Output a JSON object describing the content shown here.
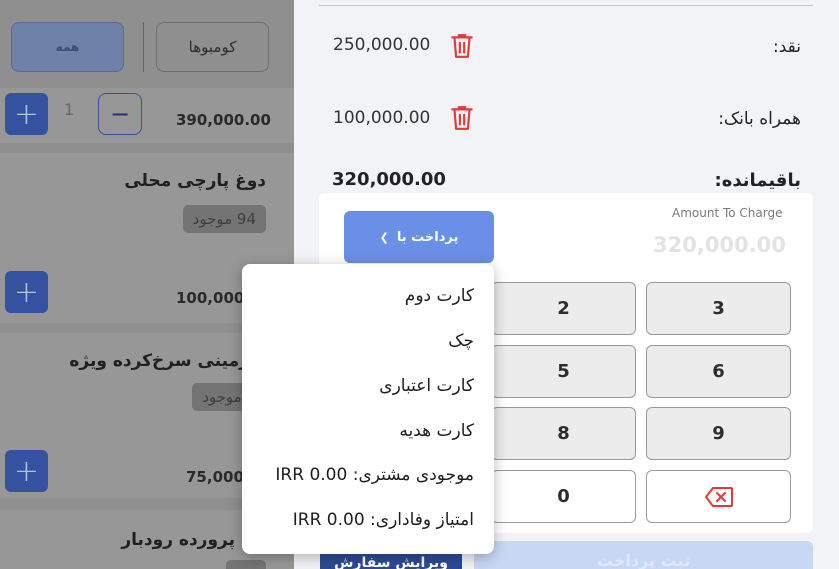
{
  "tabs": {
    "all": "همه",
    "combos": "کومبوها"
  },
  "products": [
    {
      "price": "390,000.00",
      "quantity": "1"
    },
    {
      "name": "دوغ پارچی محلی",
      "stock": "94 موجود",
      "price": "100,000"
    },
    {
      "name": "ب‌زمینی سرخ‌کرده ویژه",
      "stock": "6 موجود",
      "price": "75,000"
    },
    {
      "name": "ون پرورده رودبار"
    }
  ],
  "payments": {
    "cash": {
      "label": "نقد:",
      "amount": "250,000.00"
    },
    "mobile_bank": {
      "label": "همراه بانک:",
      "amount": "100,000.00"
    },
    "remaining": {
      "label": "باقیمانده:",
      "amount": "320,000.00"
    }
  },
  "charge": {
    "label": "Amount To Charge",
    "value": "320,000.00"
  },
  "pay_with": {
    "label": "پرداخت با"
  },
  "keypad": [
    "3",
    "2",
    "6",
    "5",
    "9",
    "8",
    "0"
  ],
  "menu": {
    "items": [
      "کارت دوم",
      "چک",
      "کارت اعتباری",
      "کارت هدیه",
      "موجودی مشتری: IRR 0.00",
      "امتیاز وفاداری: IRR 0.00"
    ]
  },
  "actions": {
    "submit": "ثبت پرداخت",
    "edit_order": "ویرایش سفارش"
  },
  "colors": {
    "accent": "#6a8fe6",
    "danger": "#e53935",
    "primary_dark": "#2e4a96"
  }
}
